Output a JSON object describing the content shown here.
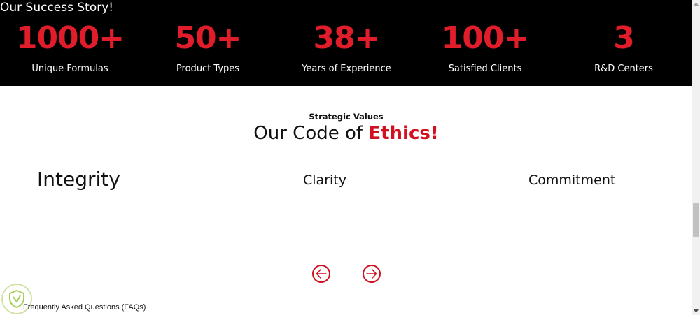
{
  "success": {
    "title": "Our Success Story!",
    "stats": [
      {
        "value": "1000+",
        "label": "Unique Formulas"
      },
      {
        "value": "50+",
        "label": "Product Types"
      },
      {
        "value": "38+",
        "label": "Years of Experience"
      },
      {
        "value": "100+",
        "label": "Satisfied Clients"
      },
      {
        "value": "3",
        "label": "R&D Centers"
      }
    ]
  },
  "ethics": {
    "eyebrow": "Strategic Values",
    "title_prefix": "Our Code of",
    "title_accent": "Ethics!",
    "values": [
      "Integrity",
      "Clarity",
      "Commitment"
    ],
    "prev_icon": "arrow-left-circle-icon",
    "next_icon": "arrow-right-circle-icon"
  },
  "footer": {
    "faq_label": "Frequently Asked Questions (FAQs)",
    "badge_icon": "shield-badge-icon"
  },
  "colors": {
    "accent": "#d0111f",
    "stat_value": "#e11d2c",
    "band_background": "#000000"
  }
}
